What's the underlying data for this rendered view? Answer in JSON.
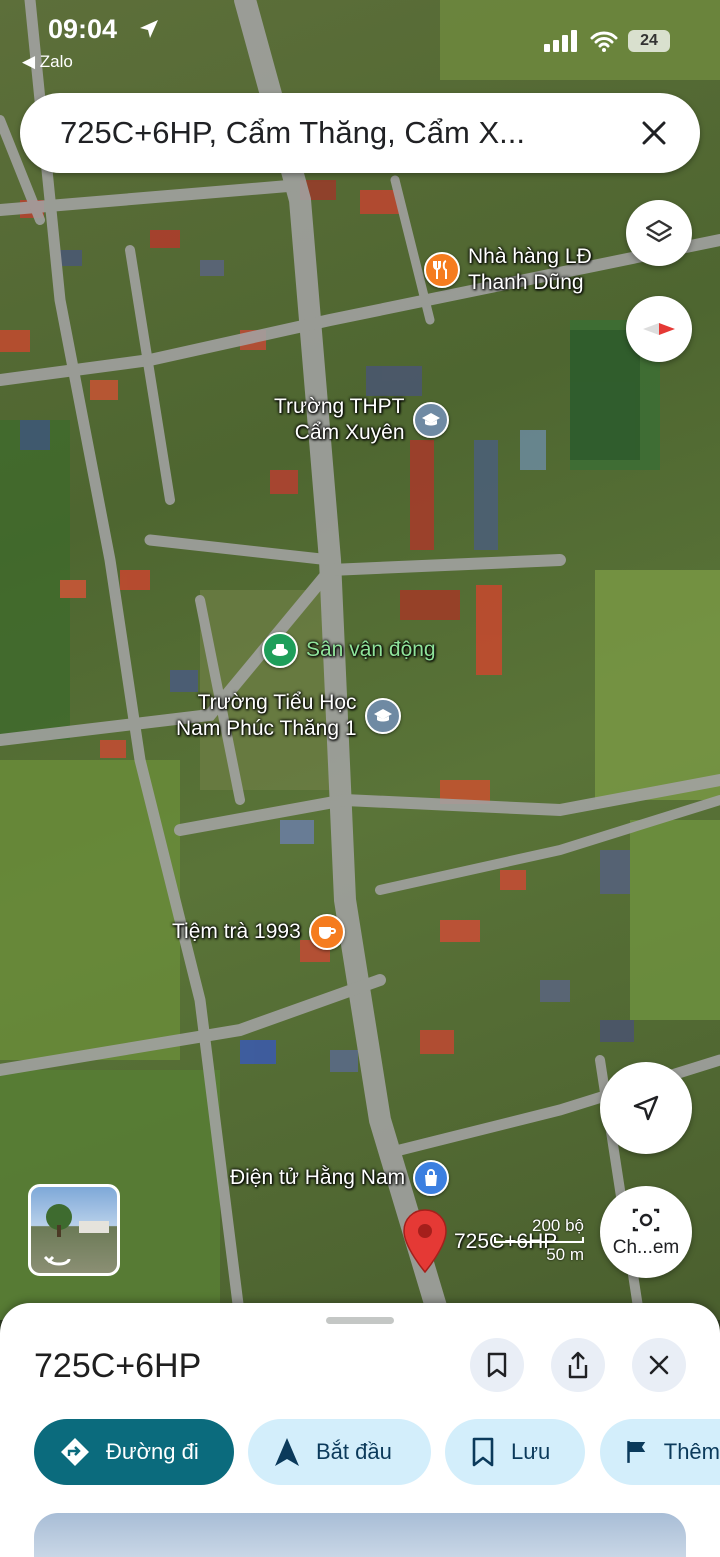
{
  "status_bar": {
    "time": "09:04",
    "back_app": "◀ Zalo",
    "battery": "24"
  },
  "search": {
    "query": "725C+6HP, Cẩm Thăng, Cẩm X..."
  },
  "map": {
    "type": "satellite",
    "pois": [
      {
        "name": "Nhà hàng LĐ\nThanh Dũng",
        "line1": "Nhà hàng LĐ",
        "line2": "Thanh Dũng",
        "icon": "restaurant-icon",
        "color": "#f57c1f"
      },
      {
        "line1": "Trường THPT",
        "line2": "Cẩm Xuyên",
        "icon": "school-icon",
        "color": "#6f8aa3"
      },
      {
        "line1": "Sân vận động",
        "icon": "stadium-icon",
        "color": "#1e9e5a"
      },
      {
        "line1": "Trường Tiểu Học",
        "line2": "Nam Phúc Thăng 1",
        "icon": "school-icon",
        "color": "#6f8aa3"
      },
      {
        "line1": "Tiệm trà 1993",
        "icon": "cafe-icon",
        "color": "#f57c1f"
      },
      {
        "line1": "Điện tử Hằng Nam",
        "icon": "shopping-icon",
        "color": "#3b7fe0"
      }
    ],
    "pin_label": "725C+6HP",
    "scale": {
      "imperial": "200 bộ",
      "metric": "50 m"
    },
    "lens_label": "Ch...em"
  },
  "sheet": {
    "title": "725C+6HP",
    "chips": [
      {
        "label": "Đường đi",
        "icon": "directions-icon"
      },
      {
        "label": "Bắt đầu",
        "icon": "navigation-arrow-icon"
      },
      {
        "label": "Lưu",
        "icon": "bookmark-icon"
      },
      {
        "label": "Thêm",
        "icon": "flag-icon"
      }
    ]
  },
  "colors": {
    "primary_chip": "#0b6b7d",
    "secondary_chip": "#d3eefb",
    "pin": "#e53935"
  }
}
